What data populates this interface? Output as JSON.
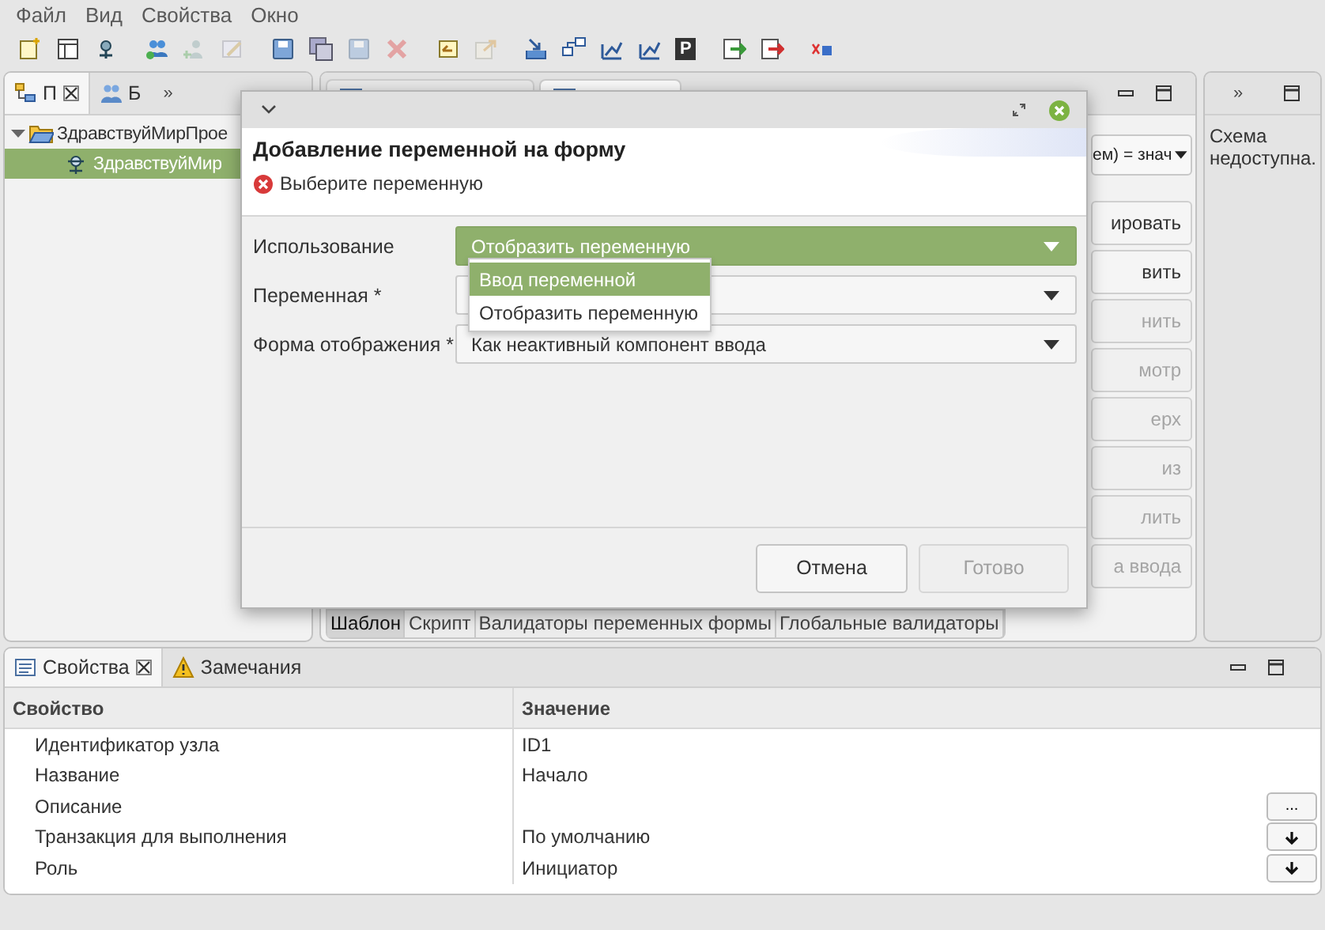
{
  "menu": [
    {
      "label": "Файл"
    },
    {
      "label": "Вид"
    },
    {
      "label": "Свойства"
    },
    {
      "label": "Окно"
    }
  ],
  "toolbar": [
    [
      {
        "kind": "new",
        "disabled": false
      },
      {
        "kind": "window",
        "disabled": false
      },
      {
        "kind": "gear",
        "disabled": false
      }
    ],
    [
      {
        "kind": "users",
        "disabled": false
      },
      {
        "kind": "user",
        "disabled": true
      },
      {
        "kind": "edit",
        "disabled": true
      }
    ],
    [
      {
        "kind": "save",
        "disabled": false
      },
      {
        "kind": "saveall",
        "disabled": false
      },
      {
        "kind": "save",
        "disabled": true
      },
      {
        "kind": "delete",
        "disabled": true
      }
    ],
    [
      {
        "kind": "undo",
        "disabled": false
      },
      {
        "kind": "export",
        "disabled": true
      }
    ],
    [
      {
        "kind": "import",
        "disabled": false
      },
      {
        "kind": "tree",
        "disabled": false
      },
      {
        "kind": "chart",
        "disabled": false
      },
      {
        "kind": "chart",
        "disabled": false
      },
      {
        "kind": "letter",
        "label": "P",
        "disabled": false
      }
    ],
    [
      {
        "kind": "out-green",
        "disabled": false
      },
      {
        "kind": "out-red",
        "disabled": false
      }
    ],
    [
      {
        "kind": "small",
        "disabled": false
      }
    ]
  ],
  "left_panel": {
    "tabs": [
      {
        "label": "П",
        "kind": "tree",
        "selected": true,
        "closable": true
      },
      {
        "label": "Б",
        "kind": "people",
        "selected": false,
        "closable": false
      }
    ],
    "overflow": "»",
    "tree": [
      {
        "label": "ЗдравствуйМирПрое",
        "expanded": true,
        "selected": false,
        "children": [
          {
            "label": "ЗдравствуйМир",
            "selected": true
          }
        ]
      }
    ]
  },
  "editor": {
    "tabs": [
      {
        "selected": false
      },
      {
        "selected": true
      }
    ],
    "combo": {
      "value": "ем) = знач"
    },
    "buttons": [
      {
        "label": "ировать",
        "disabled": false
      },
      {
        "label": "вить",
        "disabled": false
      },
      {
        "label": "нить",
        "disabled": true
      },
      {
        "label": "мотр",
        "disabled": true
      },
      {
        "label": "ерх",
        "disabled": true
      },
      {
        "label": "из",
        "disabled": true
      },
      {
        "label": "лить",
        "disabled": true
      },
      {
        "label": "а ввода",
        "disabled": true
      }
    ],
    "bottom_tabs": [
      {
        "label": "Шаблон",
        "selected": true
      },
      {
        "label": "Скрипт",
        "selected": false
      },
      {
        "label": "Валидаторы переменных формы",
        "selected": false
      },
      {
        "label": "Глобальные валидаторы",
        "selected": false
      }
    ]
  },
  "right_panel": {
    "overflow": "»",
    "message": "Схема недоступна."
  },
  "dialog": {
    "title": "Добавление переменной на форму",
    "message": "Выберите переменную",
    "fields": [
      {
        "label": "Использование",
        "value": "Отобразить переменную",
        "highlighted": true
      },
      {
        "label": "Переменная *",
        "highlighted": false
      },
      {
        "label": "Форма отображения *",
        "value": "Как неактивный компонент ввода",
        "highlighted": false
      }
    ],
    "dropdown": {
      "options": [
        {
          "label": "Ввод переменной",
          "selected": true
        },
        {
          "label": "Отобразить переменную",
          "selected": false
        }
      ]
    },
    "buttons": [
      {
        "label": "Отмена",
        "disabled": false
      },
      {
        "label": "Готово",
        "disabled": true
      }
    ]
  },
  "properties_panel": {
    "tabs": [
      {
        "label": "Свойства",
        "kind": "properties",
        "selected": true,
        "closable": true
      },
      {
        "label": "Замечания",
        "kind": "warning",
        "selected": false,
        "closable": false
      }
    ],
    "columns": [
      "Свойство",
      "Значение"
    ],
    "rows": [
      {
        "property": "Идентификатор узла",
        "value": "ID1"
      },
      {
        "property": "Название",
        "value": "Начало"
      },
      {
        "property": "Описание",
        "editor": {
          "kind": "button",
          "label": "..."
        }
      },
      {
        "property": "Транзакция для выполнения",
        "value": "По умолчанию",
        "editor": {
          "kind": "dropdown"
        }
      },
      {
        "property": "Роль",
        "value": "Инициатор",
        "editor": {
          "kind": "dropdown"
        }
      }
    ]
  }
}
